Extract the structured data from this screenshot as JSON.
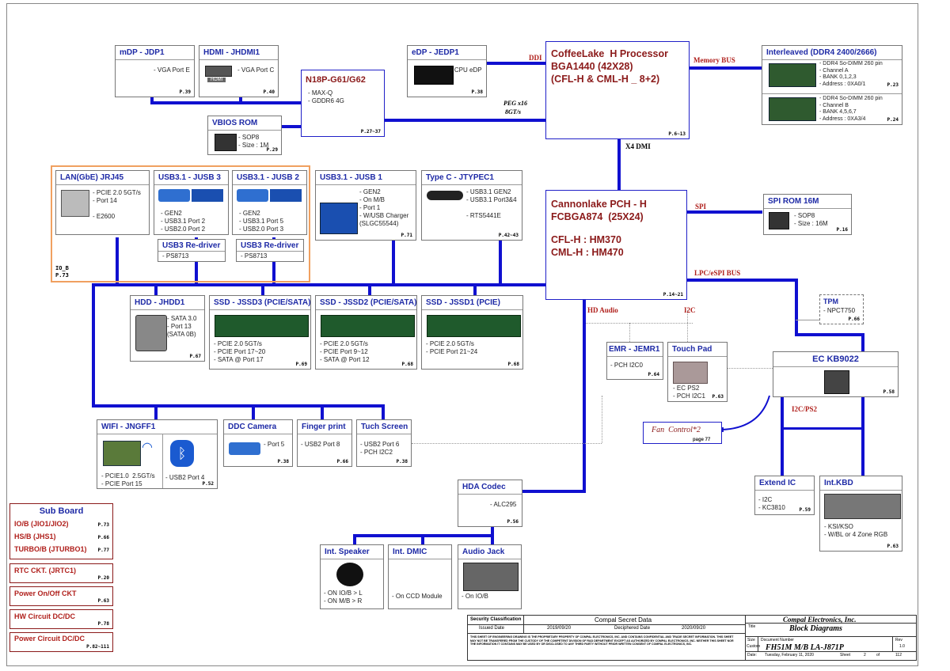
{
  "labels": {
    "ddi": "DDI",
    "memory_bus": "Memory BUS",
    "peg": "PEG  x16",
    "peg_speed": "8GT/s",
    "x4dmi": "X4 DMI",
    "spi": "SPI",
    "lpc": "LPC/eSPI BUS",
    "hd_audio": "HD Audio",
    "i2c": "I2C",
    "i2c_ps2": "I2C/PS2",
    "io_b": "IO_B",
    "io_b_page": "P.73"
  },
  "cpu": {
    "lines": "CoffeeLake  H Processor\nBGA1440 (42X28)\n(CFL-H & CML-H _ 8+2)",
    "page": "P.6~13"
  },
  "pch": {
    "lines1": "Cannonlake PCH - H\nFCBGA874  (25X24)",
    "lines2": "CFL-H : HM370\nCML-H : HM470",
    "page": "P.14~21"
  },
  "boxes": {
    "mdp": {
      "title": "mDP - JDP1",
      "text": "- VGA Port E",
      "page": "P.39"
    },
    "hdmi": {
      "title": "HDMI - JHDMI1",
      "text": "- VGA Port C",
      "page": "P.40",
      "badge": "HDMI"
    },
    "n18p": {
      "title": "N18P-G61/G62",
      "text": "- MAX-Q\n- GDDR6 4G",
      "page": "P.27~37"
    },
    "vbios": {
      "title": "VBIOS ROM",
      "text": "- SOP8\n- Size : 1M",
      "page": "P.29"
    },
    "edp": {
      "title": "eDP - JEDP1",
      "text": "- CPU eDP",
      "page": "P.38"
    },
    "ddr": {
      "title": "Interleaved (DDR4 2400/2666)",
      "text_a": "- DDR4 So-DIMM 260 pin\n- Channel A\n- BANK 0,1,2,3\n- Address : 0XA0/1",
      "page_a": "P.23",
      "text_b": "- DDR4 So-DIMM 260 pin\n- Channel B\n- BANK 4,5,6,7\n- Address : 0XA3/4",
      "page_b": "P.24"
    },
    "lan": {
      "title": "LAN(GbE) JRJ45",
      "text": "- PCIE 2.0 5GT/s\n- Port 14\n\n- E2600"
    },
    "usb3": {
      "title": "USB3.1 - JUSB 3",
      "text": "- GEN2\n- USB3.1 Port 2\n- USB2.0 Port 2"
    },
    "usb2": {
      "title": "USB3.1 - JUSB 2",
      "text": "- GEN2\n- USB3.1 Port 5\n- USB2.0 Port 3"
    },
    "redrv1": {
      "title": "USB3 Re-driver",
      "text": "- PS8713"
    },
    "redrv2": {
      "title": "USB3 Re-driver",
      "text": "- PS8713"
    },
    "usb1": {
      "title": "USB3.1 - JUSB 1",
      "text": "- GEN2\n- On M/B\n- Port 1\n- W/USB Charger\n(SLGC55544)",
      "page": "P.71"
    },
    "typec": {
      "title": "Type C - JTYPEC1",
      "text": "- USB3.1 GEN2\n- USB3.1 Port3&4\n\n- RTS5441E",
      "page": "P.42~43"
    },
    "spirom": {
      "title": "SPI ROM 16M",
      "text": "- SOP8\n- Size : 16M",
      "page": "P.16"
    },
    "hdd": {
      "title": "HDD - JHDD1",
      "text": "- SATA 3.0\n- Port 13\n(SATA 0B)",
      "page": "P.67"
    },
    "ssd3": {
      "title": "SSD - JSSD3 (PCIE/SATA)",
      "text": "- PCIE 2.0 5GT/s\n- PCIE Port 17~20\n- SATA @ Port 17",
      "page": "P.69"
    },
    "ssd2": {
      "title": "SSD - JSSD2 (PCIE/SATA)",
      "text": "- PCIE 2.0 5GT/s\n- PCIE Port 9~12\n- SATA @ Port 12",
      "page": "P.68"
    },
    "ssd1": {
      "title": "SSD - JSSD1 (PCIE)",
      "text": "- PCIE 2.0 5GT/s\n- PCIE Port 21~24",
      "page": "P.68"
    },
    "tpm": {
      "title": "TPM",
      "text": "- NPCT750",
      "page": "P.66"
    },
    "emr": {
      "title": "EMR - JEMR1",
      "text": "- PCH I2C0",
      "page": "P.64"
    },
    "touchpad": {
      "title": "Touch Pad",
      "text": "- EC PS2\n- PCH I2C1",
      "page": "P.63"
    },
    "ec": {
      "title": "EC KB9022",
      "page": "P.58"
    },
    "wifi": {
      "title": "WIFI - JNGFF1",
      "text": "- PCIE1.0  2.5GT/s\n- PCIE Port 15",
      "text2": "- USB2 Port 4",
      "page": "P.52"
    },
    "ddc": {
      "title": "DDC Camera",
      "text": "- Port 5",
      "page": "P.38"
    },
    "finger": {
      "title": "Finger print",
      "text": "- USB2 Port 8",
      "page": "P.66"
    },
    "tuch": {
      "title": "Tuch Screen",
      "text": "- USB2 Port 6\n- PCH I2C2",
      "page": "P.38"
    },
    "hda": {
      "title": "HDA Codec",
      "text": "- ALC295",
      "page": "P.56"
    },
    "speaker": {
      "title": "Int. Speaker",
      "text": "- ON IO/B > L\n- ON M/B > R"
    },
    "dmic": {
      "title": "Int. DMIC",
      "text": "- On CCD Module"
    },
    "jack": {
      "title": "Audio Jack",
      "text": "- On IO/B"
    },
    "extend": {
      "title": "Extend IC",
      "text": "- I2C\n- KC3810",
      "page": "P.59"
    },
    "kbd": {
      "title": "Int.KBD",
      "text": "- KSI/KSO\n- W/BL or 4 Zone RGB",
      "page": "P.63"
    },
    "fan": {
      "title": "Fan  Control*2",
      "page": "page 77"
    }
  },
  "side": [
    {
      "title": "Sub Board",
      "rows": [
        [
          "IO/B (JIO1/JIO2)",
          "P.73"
        ],
        [
          "HS/B (JHS1)",
          "P.66"
        ],
        [
          "TURBO/B (JTURBO1)",
          "P.77"
        ]
      ]
    },
    {
      "title": "RTC CKT. (JRTC1)",
      "page": "P.20"
    },
    {
      "title": "Power On/Off  CKT",
      "page": "P.63"
    },
    {
      "title": "HW Circuit DC/DC",
      "page": "P.78"
    },
    {
      "title": "Power Circuit DC/DC",
      "page": "P.82~111"
    }
  ],
  "titleblock": {
    "sec": "Security Classification",
    "secval": "Compal Secret Data",
    "company": "Compal Electronics, Inc.",
    "issued": "Issued Date",
    "idate": "2019/09/20",
    "deciph": "Deciphered Date",
    "ddate": "2020/09/20",
    "title_lbl": "Title",
    "title": "Block Diagrams",
    "notice": "THIS SHEET OF ENGINEERING DRAWING IS THE PROPRIETARY PROPERTY OF COMPAL ELECTRONICS, INC. AND CONTAINS CONFIDENTIAL AND TRADE SECRET INFORMATION. THIS SHEET MAY NOT BE TRANSFERED FROM THE CUSTODY OF THE COMPETENT DIVISION OF R&D DEPARTMENT EXCEPT AS AUTHORIZED BY COMPAL ELECTRONICS, INC. NEITHER THIS SHEET NOR THE INFORMATION IT CONTAINS MAY BE USED BY OR DISCLOSED TO ANY THIRD PARTY WITHOUT PRIOR WRITTEN CONSENT OF COMPAL ELECTRONICS, INC.",
    "size": "Size",
    "custom": "Custom",
    "docnum_lbl": "Document Number",
    "docnum": "FH51M M/B LA-J871P",
    "rev": "Rev",
    "revval": "1.0",
    "date_lbl": "Date:",
    "date": "Tuesday, February 11, 2020",
    "sheet_lbl": "Sheet",
    "sheet": "2",
    "of": "of",
    "total": "112"
  }
}
